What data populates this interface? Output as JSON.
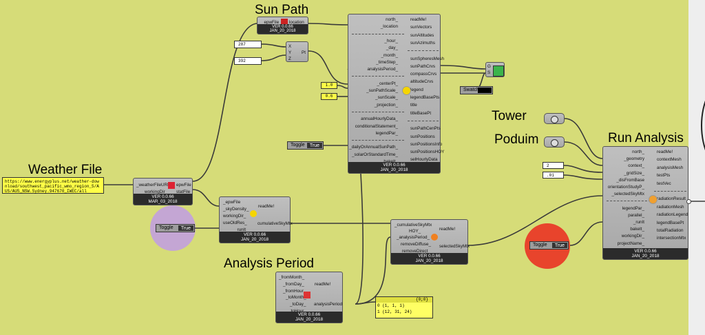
{
  "titles": {
    "sun_path": "Sun Path",
    "weather_file": "Weather File",
    "analysis_period": "Analysis Period",
    "tower": "Tower",
    "podium": "Poduim",
    "run_analysis": "Run Analysis"
  },
  "weather_panel": {
    "text": "https://www.energyplus.net/weather-download/southwest_pacific_wmo_region_5/AUS/AUS_NSW.Sydney.947670_IWEC/all"
  },
  "download_weather": {
    "inputs": [
      "_weatherFileURL",
      "workingDir_"
    ],
    "outputs": [
      "epwFile",
      "statFile"
    ],
    "version": "VER 0.0.66",
    "date": "MAR_03_2018"
  },
  "import_epw": {
    "input": "_epwFile",
    "output": "location",
    "version": "VER 0.0.66",
    "date": "JAN_20_2018"
  },
  "sliders": {
    "s1": "287",
    "s2": "392",
    "scale": "1.0",
    "sunscale": "0.6"
  },
  "pt_component": {
    "inputs": [
      "X",
      "Y",
      "Z"
    ],
    "output": "Pt"
  },
  "sunpath": {
    "inputs": [
      "north_",
      "_location",
      "--------------",
      "_hour_",
      "_day_",
      "_month_",
      "_timeStep_",
      "analysisPeriod_",
      "--------------",
      "_centerPt_",
      "_sunPathScale_",
      "_sunScale_",
      "_projection_",
      "--------------",
      "annualHourlyData_",
      "conditionalStatement_",
      "legendPar_",
      "--------------",
      "_dailyOrAnnualSunPath_",
      "_solarOrStandardTime_",
      "bakeIt_"
    ],
    "outputs": [
      "readMe!",
      "sunVectors",
      "sunAltitudes",
      "sunAzimuths",
      "--------------",
      "sunSpheresMesh",
      "sunPathCrvs",
      "compassCrvs",
      "altitudeCrvs",
      "legend",
      "legendBasePts",
      "title",
      "titleBasePt",
      "--------------",
      "sunPathCenPts",
      "sunPositions",
      "sunPositionsInfo",
      "sunPositionsHOY",
      "selHourlyData"
    ],
    "version": "VER 0.0.66",
    "date": "JAN_20_2018"
  },
  "custom_preview": {
    "g": "G",
    "s": "S"
  },
  "swatch": {
    "label": "Swatch"
  },
  "toggles": {
    "sunpath": {
      "label": "Toggle",
      "value": "True"
    },
    "skymtx": {
      "label": "Toggle",
      "value": "True"
    },
    "run": {
      "label": "Toggle",
      "value": "True"
    }
  },
  "sky_mtx": {
    "inputs": [
      "_epwFile",
      "_skyDensity_",
      "workingDir_",
      "useOldRes_",
      "_runIt"
    ],
    "outputs": [
      "readMe!",
      "cumulativeSkyMtx"
    ],
    "version": "VER 0.0.66",
    "date": "JAN_20_2018"
  },
  "select_sky": {
    "inputs": [
      "_cumulativeSkyMtx",
      "HOY_",
      "_analysisPeriod_",
      "removeDiffuse_",
      "removeDirect_"
    ],
    "outputs": [
      "readMe!",
      "selectedSkyMtx"
    ],
    "version": "VER 0.0.66",
    "date": "JAN_20_2018"
  },
  "analysis_period": {
    "inputs": [
      "_fromMonth_",
      "_fromDay_",
      "_fromHour_",
      "_toMonth_",
      "_toDay_",
      "_toHour_"
    ],
    "outputs": [
      "readMe!",
      "analysisPeriod"
    ],
    "version": "VER 0.0.66",
    "date": "JAN_20_2018"
  },
  "period_panel": {
    "header": "{0;0}",
    "row0": "0 (1, 1, 1)",
    "row1": "1 (12, 31, 24)"
  },
  "radiation": {
    "inputs": [
      "north_",
      "_geometry",
      "context_",
      "_gridSize_",
      "_disFromBase",
      "orientationStudyP_",
      "_selectedSkyMtx",
      "--------------",
      "legendPar_",
      "parallel_",
      "_runIt",
      "bakeIt_",
      "workingDir_",
      "projectName_"
    ],
    "outputs": [
      "readMe!",
      "contextMesh",
      "analysisMesh",
      "testPts",
      "testVec",
      "--------------",
      "radiationResult",
      "radiationMesh",
      "radiationLegend",
      "legendBasePt",
      "totalRadiation",
      "intersectionMtx"
    ],
    "version": "VER 0.0.66",
    "date": "JAN_20_2018"
  },
  "inputs_small": {
    "grid": "2",
    "dist": ".01"
  },
  "colors": {
    "canvas": "#d6dc78",
    "component": "#b4b4b4",
    "panel": "#ffff47",
    "toggle_circle": "#c6a8d6",
    "run_circle": "#e8442c"
  }
}
